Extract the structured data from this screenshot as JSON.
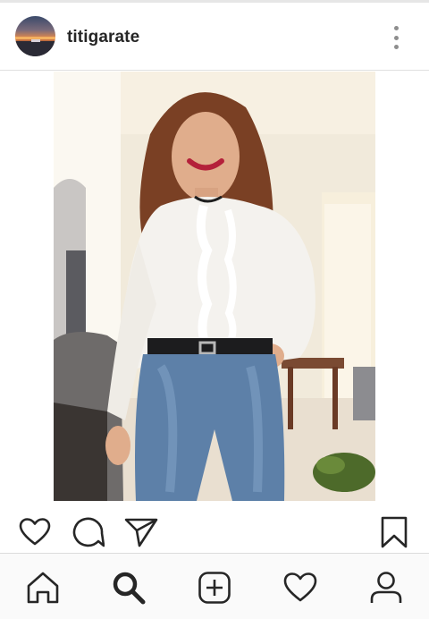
{
  "post": {
    "username": "titigarate",
    "avatar_icon": "profile-avatar",
    "more_icon": "more-vertical-icon",
    "image_description_icon": "post-photo"
  },
  "actions": {
    "like_icon": "heart-icon",
    "comment_icon": "comment-icon",
    "share_icon": "send-icon",
    "save_icon": "bookmark-icon"
  },
  "nav": {
    "items": [
      {
        "name": "home",
        "icon": "home-icon"
      },
      {
        "name": "search",
        "icon": "search-icon",
        "active": true
      },
      {
        "name": "new-post",
        "icon": "add-square-icon"
      },
      {
        "name": "activity",
        "icon": "heart-icon"
      },
      {
        "name": "profile",
        "icon": "user-icon"
      }
    ]
  },
  "colors": {
    "text": "#262626",
    "icon": "#262626",
    "divider": "#dbdbdb",
    "nav_bg": "#fafafa"
  }
}
